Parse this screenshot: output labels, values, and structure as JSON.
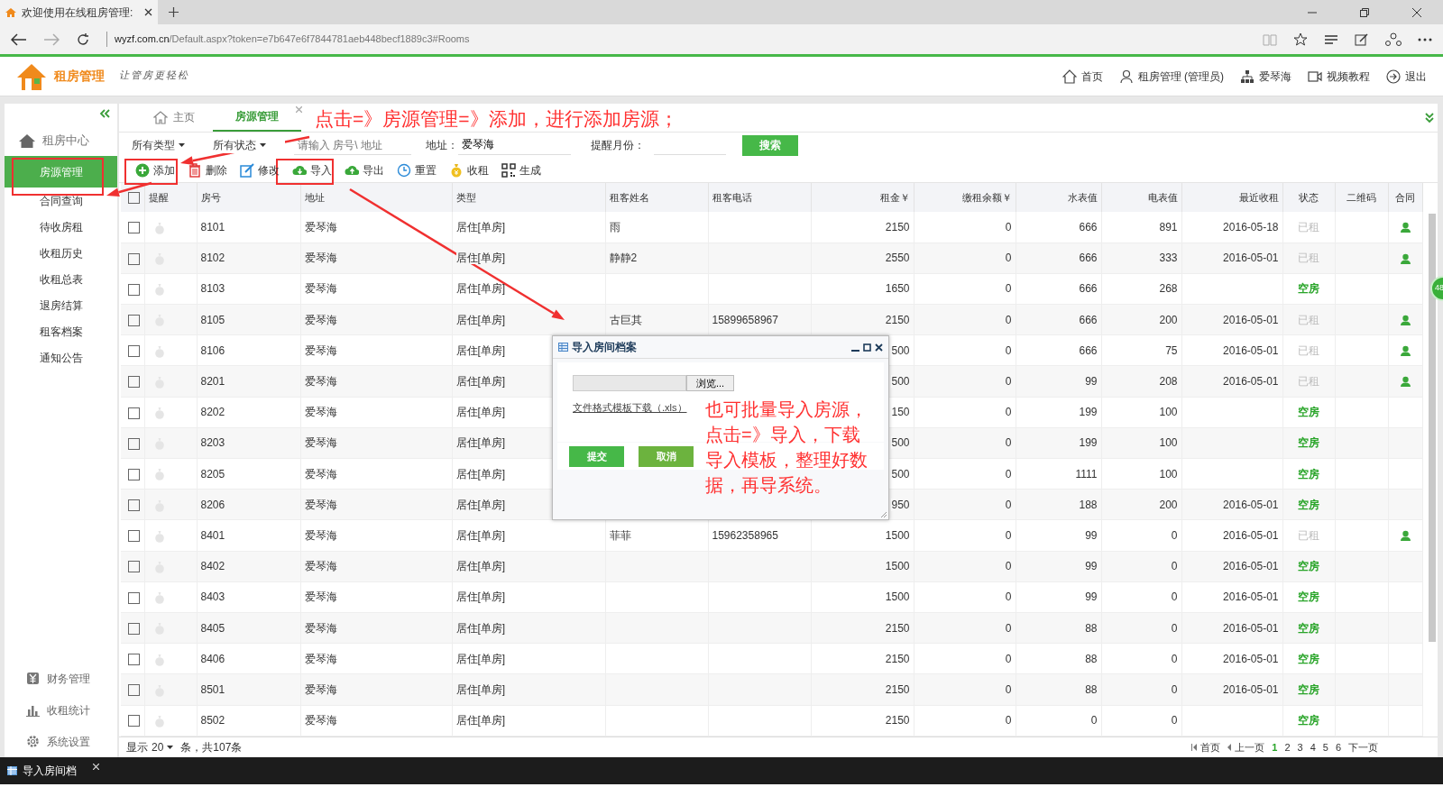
{
  "browser": {
    "tab_title": "欢迎使用在线租房管理:",
    "url_host": "wyzf.com.cn",
    "url_path": "/Default.aspx?token=e7b647e6f7844781aeb448becf1889c3#Rooms"
  },
  "app_header": {
    "brand": "租房管理",
    "slogan": "让管房更轻松",
    "links": [
      {
        "kind": "home",
        "label": "首页"
      },
      {
        "kind": "user",
        "label": "租房管理 (管理员)"
      },
      {
        "kind": "org",
        "label": "爱琴海"
      },
      {
        "kind": "video",
        "label": "视频教程"
      },
      {
        "kind": "logout",
        "label": "退出"
      }
    ]
  },
  "sidebar": {
    "heading": "租房中心",
    "items": [
      {
        "label": "房源管理",
        "selected": true
      },
      {
        "label": "合同查询",
        "selected": false
      },
      {
        "label": "待收房租",
        "selected": false
      },
      {
        "label": "收租历史",
        "selected": false
      },
      {
        "label": "收租总表",
        "selected": false
      },
      {
        "label": "退房结算",
        "selected": false
      },
      {
        "label": "租客档案",
        "selected": false
      },
      {
        "label": "通知公告",
        "selected": false
      }
    ],
    "bottom_items": [
      {
        "kind": "finance",
        "label": "财务管理"
      },
      {
        "kind": "stats",
        "label": "收租统计"
      },
      {
        "kind": "settings",
        "label": "系统设置"
      }
    ]
  },
  "tabs": [
    {
      "label": "主页",
      "kind": "home",
      "selected": false,
      "closable": false
    },
    {
      "label": "房源管理",
      "kind": "plain",
      "selected": true,
      "closable": true
    }
  ],
  "filters": {
    "type_dropdown": "所有类型",
    "status_dropdown": "所有状态",
    "search_placeholder": "请输入 房号\\ 地址",
    "address_label": "地址：",
    "address_value": "爱琴海",
    "month_label": "提醒月份：",
    "search_button": "搜索"
  },
  "toolbar": [
    {
      "kind": "add",
      "label": "添加"
    },
    {
      "kind": "delete",
      "label": "删除"
    },
    {
      "kind": "edit",
      "label": "修改"
    },
    {
      "kind": "import",
      "label": "导入"
    },
    {
      "kind": "export",
      "label": "导出"
    },
    {
      "kind": "reset",
      "label": "重置"
    },
    {
      "kind": "collect",
      "label": "收租"
    },
    {
      "kind": "generate",
      "label": "生成"
    }
  ],
  "table": {
    "select_all_checked": false,
    "columns": [
      "提醒",
      "房号",
      "地址",
      "类型",
      "租客姓名",
      "租客电话",
      "租金￥",
      "缴租余额￥",
      "水表值",
      "电表值",
      "最近收租",
      "状态",
      "二维码",
      "合同"
    ],
    "rows": [
      {
        "checked": false,
        "room": "8101",
        "address": "爱琴海",
        "type": "居住[单房]",
        "tenant": "雨",
        "rent": "2150",
        "balance": "0",
        "water": "666",
        "power": "891",
        "last_paid": "2016-05-18",
        "status": "已租",
        "vacant": false,
        "contract": true
      },
      {
        "checked": false,
        "room": "8102",
        "address": "爱琴海",
        "type": "居住[单房]",
        "tenant": "静静2",
        "rent": "2550",
        "balance": "0",
        "water": "666",
        "power": "333",
        "last_paid": "2016-05-01",
        "status": "已租",
        "vacant": false,
        "contract": true
      },
      {
        "checked": false,
        "room": "8103",
        "address": "爱琴海",
        "type": "居住[单房]",
        "rent": "1650",
        "balance": "0",
        "water": "666",
        "power": "268",
        "status": "空房",
        "vacant": true,
        "contract": false
      },
      {
        "checked": false,
        "room": "8105",
        "address": "爱琴海",
        "type": "居住[单房]",
        "tenant": "古巨其",
        "phone": "15899658967",
        "rent": "2150",
        "balance": "0",
        "water": "666",
        "power": "200",
        "last_paid": "2016-05-01",
        "status": "已租",
        "vacant": false,
        "contract": true
      },
      {
        "checked": false,
        "room": "8106",
        "address": "爱琴海",
        "type": "居住[单房]",
        "rent": "500",
        "balance": "0",
        "water": "666",
        "power": "75",
        "last_paid": "2016-05-01",
        "status": "已租",
        "vacant": false,
        "contract": true
      },
      {
        "checked": false,
        "room": "8201",
        "address": "爱琴海",
        "type": "居住[单房]",
        "rent": "500",
        "balance": "0",
        "water": "99",
        "power": "208",
        "last_paid": "2016-05-01",
        "status": "已租",
        "vacant": false,
        "contract": true
      },
      {
        "checked": false,
        "room": "8202",
        "address": "爱琴海",
        "type": "居住[单房]",
        "rent": "150",
        "balance": "0",
        "water": "199",
        "power": "100",
        "status": "空房",
        "vacant": true,
        "contract": false
      },
      {
        "checked": false,
        "room": "8203",
        "address": "爱琴海",
        "type": "居住[单房]",
        "rent": "500",
        "balance": "0",
        "water": "199",
        "power": "100",
        "status": "空房",
        "vacant": true,
        "contract": false
      },
      {
        "checked": false,
        "room": "8205",
        "address": "爱琴海",
        "type": "居住[单房]",
        "rent": "500",
        "balance": "0",
        "water": "1111",
        "power": "100",
        "status": "空房",
        "vacant": true,
        "contract": false
      },
      {
        "checked": false,
        "room": "8206",
        "address": "爱琴海",
        "type": "居住[单房]",
        "rent": "950",
        "balance": "0",
        "water": "188",
        "power": "200",
        "last_paid": "2016-05-01",
        "status": "空房",
        "vacant": true,
        "contract": false
      },
      {
        "checked": false,
        "room": "8401",
        "address": "爱琴海",
        "type": "居住[单房]",
        "tenant": "菲菲",
        "phone": "15962358965",
        "rent": "1500",
        "balance": "0",
        "water": "99",
        "power": "0",
        "last_paid": "2016-05-01",
        "status": "已租",
        "vacant": false,
        "contract": true
      },
      {
        "checked": false,
        "room": "8402",
        "address": "爱琴海",
        "type": "居住[单房]",
        "rent": "1500",
        "balance": "0",
        "water": "99",
        "power": "0",
        "last_paid": "2016-05-01",
        "status": "空房",
        "vacant": true,
        "contract": false
      },
      {
        "checked": false,
        "room": "8403",
        "address": "爱琴海",
        "type": "居住[单房]",
        "rent": "1500",
        "balance": "0",
        "water": "99",
        "power": "0",
        "last_paid": "2016-05-01",
        "status": "空房",
        "vacant": true,
        "contract": false
      },
      {
        "checked": false,
        "room": "8405",
        "address": "爱琴海",
        "type": "居住[单房]",
        "rent": "2150",
        "balance": "0",
        "water": "88",
        "power": "0",
        "last_paid": "2016-05-01",
        "status": "空房",
        "vacant": true,
        "contract": false
      },
      {
        "checked": false,
        "room": "8406",
        "address": "爱琴海",
        "type": "居住[单房]",
        "rent": "2150",
        "balance": "0",
        "water": "88",
        "power": "0",
        "last_paid": "2016-05-01",
        "status": "空房",
        "vacant": true,
        "contract": false
      },
      {
        "checked": false,
        "room": "8501",
        "address": "爱琴海",
        "type": "居住[单房]",
        "rent": "2150",
        "balance": "0",
        "water": "88",
        "power": "0",
        "last_paid": "2016-05-01",
        "status": "空房",
        "vacant": true,
        "contract": false
      },
      {
        "checked": false,
        "room": "8502",
        "address": "爱琴海",
        "type": "居住[单房]",
        "rent": "2150",
        "balance": "0",
        "water": "0",
        "power": "0",
        "status": "空房",
        "vacant": true,
        "contract": false
      }
    ]
  },
  "footer": {
    "show_label": "显示",
    "page_size": "20",
    "total": "条，共107条"
  },
  "pagination": {
    "first": "首页",
    "prev": "上一页",
    "pages": [
      {
        "label": "1",
        "selected": true
      },
      {
        "label": "2",
        "selected": false
      },
      {
        "label": "3",
        "selected": false
      },
      {
        "label": "4",
        "selected": false
      },
      {
        "label": "5",
        "selected": false
      },
      {
        "label": "6",
        "selected": false
      }
    ],
    "next": "下一页"
  },
  "dialog": {
    "title": "导入房间档案",
    "browse_button": "浏览...",
    "template_link": "文件格式模板下载（.xls）",
    "submit": "提交",
    "cancel": "取消"
  },
  "annotations": [
    {
      "text": "点击=》房源管理=》添加，进行添加房源；"
    },
    {
      "text": "也可批量导入房源，点击=》导入，下载导入模板，整理好数据，再导系统。"
    }
  ],
  "side_badge": "48",
  "taskbar": {
    "window_title": "导入房间档"
  }
}
